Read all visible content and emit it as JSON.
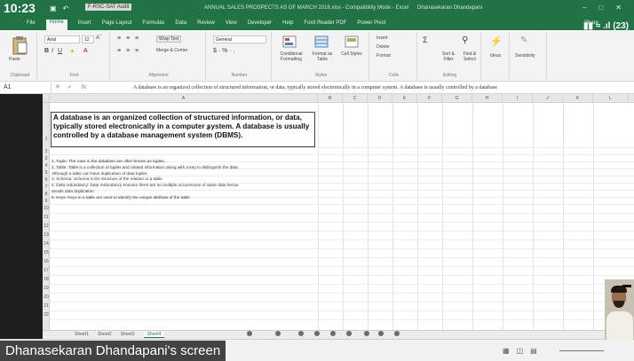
{
  "overlay": {
    "time": "10:23",
    "presenter": "Dhanasekaran Dhandapani's screen",
    "status_icons": "▮▮ ≈ .ıl (23)"
  },
  "titlebar": {
    "file_chip": "F-RSC-SAT Audit",
    "title": "ANNUAL SALES PROSPECTS AS OF MARCH 2016.xlsx - Compatibility Mode - Excel",
    "user": "Dhanasekaran Dhandapani"
  },
  "tabs": [
    "File",
    "Home",
    "Insert",
    "Page Layout",
    "Formulas",
    "Data",
    "Review",
    "View",
    "Developer",
    "Help",
    "Foxit Reader PDF",
    "Power Pivot"
  ],
  "share_label": "Share",
  "ribbon": {
    "paste_label": "Paste",
    "clipboard": "Clipboard",
    "font_name": "Arial",
    "font_size": "12",
    "font_group": "Font",
    "wrap_text": "Wrap Text",
    "merge_center": "Merge & Center",
    "alignment_group": "Alignment",
    "number_format": "General",
    "number_group": "Number",
    "conditional_formatting": "Conditional Formatting",
    "format_as_table": "Format as Table",
    "cell_styles": "Cell Styles",
    "styles_group": "Styles",
    "insert": "Insert",
    "delete": "Delete",
    "format": "Format",
    "cells_group": "Cells",
    "sort_filter": "Sort & Filter",
    "find_select": "Find & Select",
    "editing_group": "Editing",
    "ideas": "Ideas",
    "sensitivity": "Sensitivity"
  },
  "formula_bar": {
    "name_box": "A1",
    "fx": "fx",
    "formula": "A database is an organized collection of structured information, or data, typically stored electronically in a computer system. A database is usually controlled by a database"
  },
  "columns": [
    "A",
    "B",
    "C",
    "D",
    "E",
    "F",
    "G",
    "H",
    "I",
    "J",
    "K",
    "L"
  ],
  "rows": [
    "1",
    "2",
    "3",
    "4",
    "5",
    "6",
    "7",
    "8",
    "9",
    "10",
    "11",
    "12",
    "13",
    "14",
    "15",
    "16",
    "17",
    "18",
    "19",
    "20",
    "21",
    "22"
  ],
  "cell_a1": "A database is an organized collection of structured information, or data, typically stored electronically in a computer system. A database is usually controlled by a database management system (DBMS).",
  "lines": [
    "1. Tuple: The rows in the database are often known as tuples.",
    "2. Table: Table is a collection of tuples and related information along with a key to distinguish the data.",
    "Although a table can have duplication of data tuples.",
    "3. Schema: Schema is the structure of the relation or a table",
    "4. Data redundancy: Data redundancy ensures there are no multiple occurrences of same data hence",
    "avoids data duplication",
    "5. Keys: Keys in a table are used to identify the unique attribute of the table"
  ],
  "sheet_tabs": [
    "Sheet1",
    "Sheet2",
    "Sheet3",
    "Sheet4"
  ]
}
